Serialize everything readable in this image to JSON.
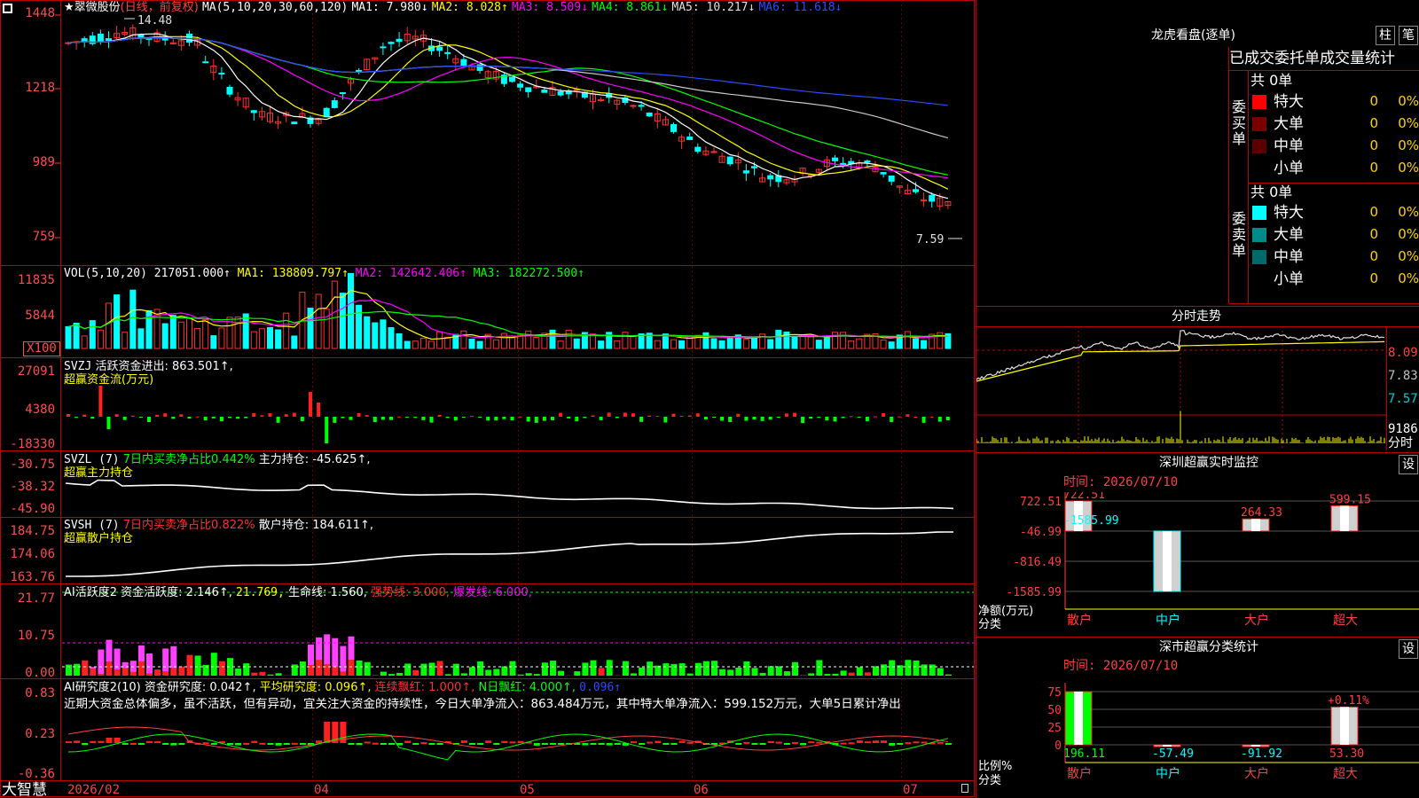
{
  "stock": {
    "name": "★翠微股份",
    "mode": "(日线，前复权)"
  },
  "ma_header": {
    "label": "MA(5,10,20,30,60,120)",
    "ma1": "MA1: 7.980↓",
    "ma2": "MA2: 8.028↑",
    "ma3": "MA3: 8.509↓",
    "ma4": "MA4: 8.861↓",
    "ma5": "MA5: 10.217↓",
    "ma6": "MA6: 11.618↓"
  },
  "price_axis": [
    "1448",
    "1218",
    "989",
    "759"
  ],
  "price_marks": {
    "high": "14.48",
    "low": "7.59"
  },
  "vol_header": {
    "label": "VOL(5,10,20)",
    "val": "217051.000↑",
    "ma1": "MA1: 138809.797↑",
    "ma2": "MA2: 142642.406↑",
    "ma3": "MA3: 182272.500↑"
  },
  "vol_axis": [
    "11835",
    "5844",
    "X100"
  ],
  "svzj": {
    "label": "SVZJ",
    "title": "活跃资金进出: 863.501↑,",
    "sub": "超赢资金流(万元)",
    "axis": [
      "27091",
      "4380",
      "-18330"
    ]
  },
  "svzl": {
    "label": "SVZL (7)",
    "ratio": "7日内买卖净占比0.442%",
    "hold": "主力持仓: -45.625↑,",
    "sub": "超赢主力持仓",
    "axis": [
      "-30.75",
      "-38.32",
      "-45.90"
    ]
  },
  "svsh": {
    "label": "SVSH (7)",
    "ratio": "7日内买卖净占比0.822%",
    "hold": "散户持仓: 184.611↑,",
    "sub": "超赢散户持仓",
    "axis": [
      "184.75",
      "174.06",
      "163.76"
    ]
  },
  "ai_active": {
    "label": "AI活跃度2",
    "act": "资金活跃度: 2.146↑,",
    "v2": "21.769,",
    "life": "生命线: 1.560,",
    "strong": "强势线: 3.000,",
    "burst": "爆发线: 6.000,",
    "axis": [
      "21.77",
      "10.75",
      "0.00"
    ]
  },
  "ai_research": {
    "label": "AI研究度2(10)",
    "res": "资金研究度: 0.042↑,",
    "avg": "平均研究度: 0.096↑,",
    "cont": "连续飘红: 1.000↑,",
    "nday": "N日飘红: 4.000↑,",
    "last": "0.096↑",
    "axis": [
      "0.83",
      "0.23",
      "-0.36"
    ],
    "desc": "近期大资金总体偏多，虽不活跃，但有异动，宜关注大资金的持续性，今日大单净流入：863.484万元，其中特大单净流入：599.152万元，大单5日累计净出"
  },
  "time_axis": {
    "brand": "大智慧",
    "labels": [
      "2026/02",
      "04",
      "05",
      "06",
      "07"
    ]
  },
  "side": {
    "title": "龙虎看盘(逐单)",
    "btn1": "柱",
    "btn2": "笔",
    "header": "已成交委托单成交量统计",
    "buy": {
      "label": "委买单",
      "total": "共 0单",
      "rows": [
        {
          "name": "特大",
          "count": "0",
          "pct": "0%",
          "color": "#ff0000"
        },
        {
          "name": "大单",
          "count": "0",
          "pct": "0%",
          "color": "#7a0000"
        },
        {
          "name": "中单",
          "count": "0",
          "pct": "0%",
          "color": "#5a0000"
        },
        {
          "name": "小单",
          "count": "0",
          "pct": "0%",
          "color": ""
        }
      ]
    },
    "sell": {
      "label": "委卖单",
      "total": "共 0单",
      "rows": [
        {
          "name": "特大",
          "count": "0",
          "pct": "0%",
          "color": "#00ffff"
        },
        {
          "name": "大单",
          "count": "0",
          "pct": "0%",
          "color": "#008a8a"
        },
        {
          "name": "中单",
          "count": "0",
          "pct": "0%",
          "color": "#006a6a"
        },
        {
          "name": "小单",
          "count": "0",
          "pct": "0%",
          "color": ""
        }
      ]
    },
    "intraday": {
      "title": "分时走势",
      "axis": [
        "8.09",
        "7.83",
        "7.57",
        "9186"
      ],
      "unit": "分时"
    },
    "monitor": {
      "title": "深圳超赢实时监控",
      "btn": "设",
      "time": "时间: 2026/07/10",
      "axis": [
        "722.51",
        "-46.99",
        "-816.49",
        "-1585.99"
      ],
      "ylabel1": "净额(万元)",
      "ylabel2": "分类",
      "bars": [
        {
          "cat": "散户",
          "value": 722.51,
          "label": "722.51"
        },
        {
          "cat": "中户",
          "value": -1585.99,
          "label": "-1585.99"
        },
        {
          "cat": "大户",
          "value": 264.33,
          "label": "264.33"
        },
        {
          "cat": "超大",
          "value": 599.15,
          "label": "599.15"
        }
      ]
    },
    "stats": {
      "title": "深市超赢分类统计",
      "btn": "设",
      "time": "时间: 2026/07/10",
      "axis": [
        "75",
        "50",
        "25",
        "0"
      ],
      "ylabel1": "比例%",
      "ylabel2": "分类",
      "annot": "+0.11%",
      "bars": [
        {
          "cat": "散户",
          "value": 196.11,
          "label": "196.11"
        },
        {
          "cat": "中户",
          "value": -57.49,
          "label": "-57.49"
        },
        {
          "cat": "大户",
          "value": -91.92,
          "label": "-91.92"
        },
        {
          "cat": "超大",
          "value": 53.3,
          "label": "53.30"
        }
      ]
    }
  },
  "chart_data": [
    {
      "type": "bar",
      "title": "深圳超赢实时监控",
      "categories": [
        "散户",
        "中户",
        "大户",
        "超大"
      ],
      "values": [
        722.51,
        -1585.99,
        264.33,
        599.15
      ],
      "ylabel": "净额(万元)",
      "xlabel": "分类",
      "ylim": [
        -1585.99,
        722.51
      ]
    },
    {
      "type": "bar",
      "title": "深市超赢分类统计",
      "categories": [
        "散户",
        "中户",
        "大户",
        "超大"
      ],
      "values": [
        196.11,
        -57.49,
        -91.92,
        53.3
      ],
      "ylabel": "比例%",
      "xlabel": "分类",
      "ylim": [
        0,
        75
      ]
    }
  ]
}
